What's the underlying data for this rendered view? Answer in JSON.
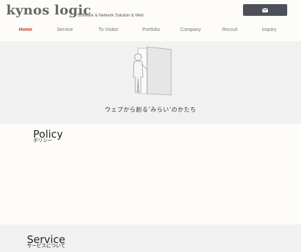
{
  "header": {
    "logo": "kynos logic",
    "tagline": "Software & Network Solution & Web",
    "mail_icon": "envelope-icon"
  },
  "nav": {
    "items": [
      {
        "label": "Home",
        "active": true
      },
      {
        "label": "Service",
        "active": false
      },
      {
        "label": "To Visitor",
        "active": false
      },
      {
        "label": "Portfolio",
        "active": false
      },
      {
        "label": "Company",
        "active": false
      },
      {
        "label": "Recruit",
        "active": false
      },
      {
        "label": "Inquiry",
        "active": false
      }
    ],
    "active_color": "#c0392b"
  },
  "hero": {
    "illustration": "person-opening-door-icon",
    "caption": "ウェブから創る’みらい’のかたち"
  },
  "sections": {
    "policy": {
      "title": "Policy",
      "subtitle": "ポリシー"
    },
    "service": {
      "title": "Service",
      "subtitle": "サービスについて"
    }
  }
}
